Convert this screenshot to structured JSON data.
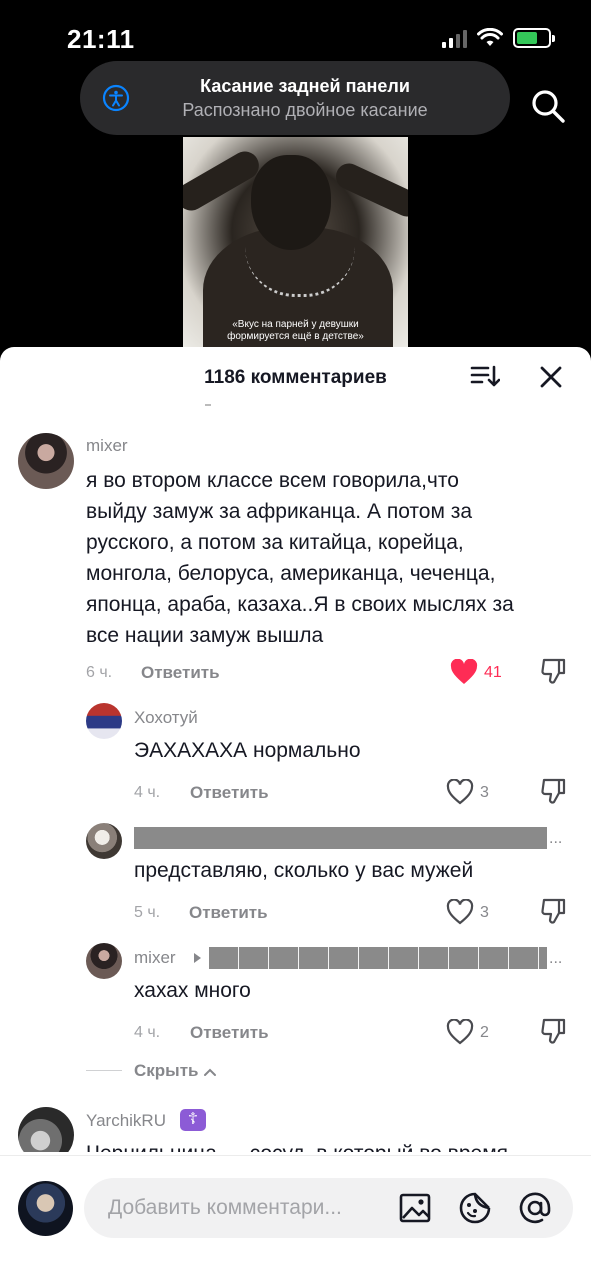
{
  "status_bar": {
    "time": "21:11",
    "battery_charging": true,
    "accent_battery": "#34c759"
  },
  "banner": {
    "title": "Касание задней панели",
    "subtitle": "Распознано двойное касание",
    "icon": "accessibility-icon"
  },
  "video": {
    "caption_line1": "«Вкус на парней у девушки",
    "caption_line2": "формируется ещё в детстве»"
  },
  "comments_header": {
    "title": "1186 комментариев",
    "sort_icon": "sort-icon",
    "close_icon": "close-icon"
  },
  "comments": [
    {
      "username": "mixer",
      "lines": [
        "я во втором классе всем говорила,что",
        "выйду замуж за африканца. А потом за",
        "русского, а потом за китайца, корейца,",
        "монгола, белоруса, американца, чеченца,",
        "японца, араба, казаха..Я в своих мыслях за",
        "все нации замуж вышла"
      ],
      "time": "6 ч.",
      "reply_label": "Ответить",
      "likes": "41",
      "liked": true
    }
  ],
  "replies": [
    {
      "username": "Хохотуй",
      "text": "ЭАХАХАХА нормально",
      "time": "4 ч.",
      "reply_label": "Ответить",
      "likes": "3"
    },
    {
      "username": "",
      "username_redacted": true,
      "ellipsis": "...",
      "text": "представляю, сколько у вас мужей",
      "time": "5 ч.",
      "reply_label": "Ответить",
      "likes": "3"
    },
    {
      "username": "mixer",
      "reply_to_redacted": true,
      "ellipsis": "...",
      "text": "хахах много",
      "time": "4 ч.",
      "reply_label": "Ответить",
      "likes": "2"
    }
  ],
  "hide_label": "Скрыть",
  "next_comment": {
    "username": "YarchikRU",
    "badge": "☦",
    "text_partial": "Чернильница — сосуд, в который во время"
  },
  "input": {
    "placeholder": "Добавить комментари...",
    "icons": [
      "image-icon",
      "emoji-icon",
      "mention-icon"
    ]
  },
  "colors": {
    "like_active": "#fe2c55",
    "secondary_text": "#86878b",
    "primary_text": "#161823"
  }
}
